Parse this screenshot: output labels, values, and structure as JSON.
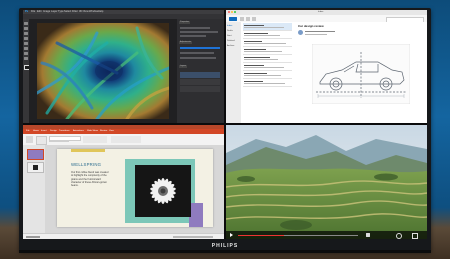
{
  "brand": "PHILIPS",
  "colors": {
    "wall": "#1465a0",
    "desk": "#4a3a2a",
    "ps_bg": "#2b2b2d",
    "outlook_accent": "#0f6cbd",
    "ppt_accent": "#d24726",
    "slide_teal": "#7cc7b8",
    "slide_purple": "#8f7bbf"
  },
  "photoshop": {
    "menu": [
      "Ps",
      "File",
      "Edit",
      "Image",
      "Layer",
      "Type",
      "Select",
      "Filter",
      "3D",
      "View",
      "Window",
      "Help"
    ],
    "panels": [
      "Properties",
      "Adjustments",
      "Layers"
    ]
  },
  "outlook": {
    "window_title": "Inbox",
    "folders": [
      "Inbox",
      "Drafts",
      "Sent",
      "Deleted",
      "Archive"
    ],
    "mail_subject": "Car design review",
    "mail_items": 8
  },
  "powerpoint": {
    "tabs": [
      "File",
      "Home",
      "Insert",
      "Design",
      "Transitions",
      "Animations",
      "Slide Show",
      "Review",
      "View"
    ],
    "slide_title": "WELLSPRING",
    "slide_body": "Our first coffee blend was created to highlight the complexity of the grains and the fruit-forward character of these African-grown beans.",
    "slide_count": 2
  },
  "video": {
    "icons": [
      "play-icon",
      "volume-icon",
      "settings-icon",
      "fullscreen-icon"
    ]
  }
}
